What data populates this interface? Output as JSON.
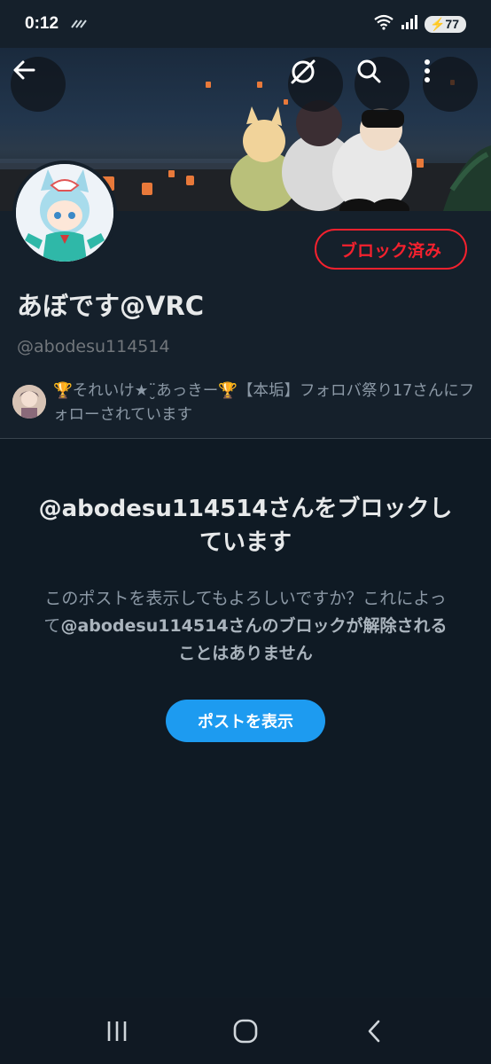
{
  "status_bar": {
    "time": "0:12",
    "battery": "77"
  },
  "header": {
    "back_icon": "arrow-left-icon",
    "grok_icon": "slash-circle-icon",
    "search_icon": "search-icon",
    "more_icon": "more-vertical-icon"
  },
  "profile": {
    "display_name": "あぼです@VRC",
    "handle": "@abodesu114514",
    "blocked_button_label": "ブロック済み",
    "followers_known_text": "🏆それいけ★¨̮あっきー🏆【本垢】フォロバ祭り17さんにフォローされています"
  },
  "blocked_notice": {
    "title": "@abodesu114514さんをブロックしています",
    "description_plain": "このポストを表示してもよろしいですか？これによって",
    "description_bold": "@abodesu114514さんのブロックが解除されることはありません",
    "show_post_label": "ポストを表示"
  },
  "colors": {
    "background": "#15202b",
    "blocked_red": "#f4212e",
    "accent_blue": "#1d9bf0"
  }
}
